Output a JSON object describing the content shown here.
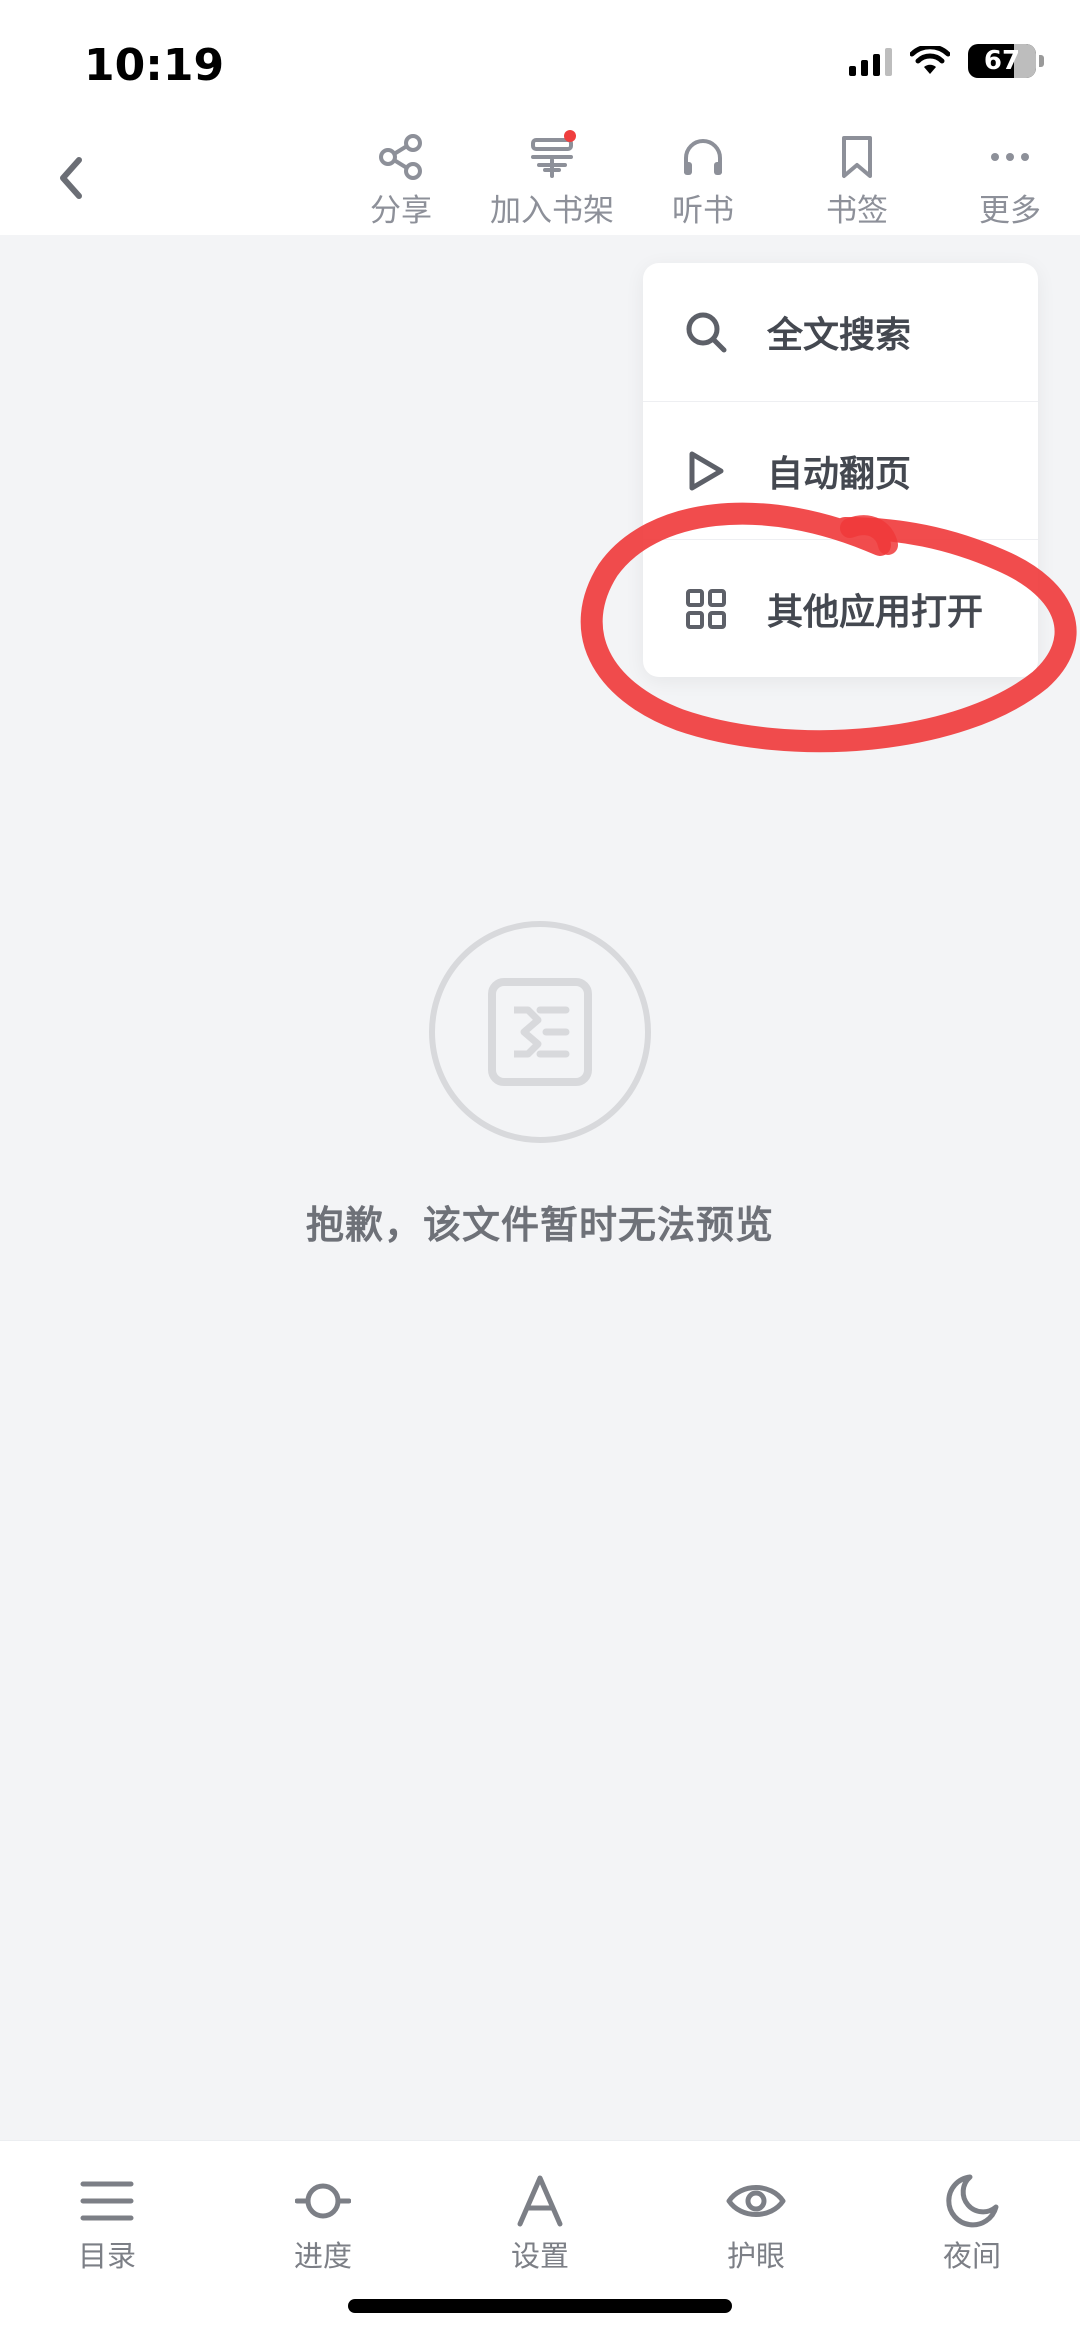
{
  "status_bar": {
    "time": "10:19",
    "battery": "67"
  },
  "toolbar": {
    "back_icon": "chevron-left-icon",
    "items": [
      {
        "label": "分享",
        "icon": "share-icon"
      },
      {
        "label": "加入书架",
        "icon": "bookshelf-add-icon",
        "has_notification_dot": true
      },
      {
        "label": "听书",
        "icon": "headphones-icon"
      },
      {
        "label": "书签",
        "icon": "bookmark-icon"
      },
      {
        "label": "更多",
        "icon": "more-dots-icon"
      }
    ]
  },
  "menu": {
    "items": [
      {
        "label": "全文搜索",
        "icon": "search-icon"
      },
      {
        "label": "自动翻页",
        "icon": "play-icon"
      },
      {
        "label": "其他应用打开",
        "icon": "grid-icon",
        "highlighted": true
      }
    ]
  },
  "empty_state": {
    "icon": "document-icon",
    "message": "抱歉，该文件暂时无法预览"
  },
  "bottom_bar": {
    "items": [
      {
        "label": "目录",
        "icon": "list-icon"
      },
      {
        "label": "进度",
        "icon": "progress-icon"
      },
      {
        "label": "设置",
        "icon": "font-a-icon"
      },
      {
        "label": "护眼",
        "icon": "eye-icon"
      },
      {
        "label": "夜间",
        "icon": "moon-icon"
      }
    ]
  },
  "colors": {
    "highlight_stroke": "#f0383a",
    "notification_dot": "#ef3e3e",
    "background": "#f3f4f6"
  }
}
